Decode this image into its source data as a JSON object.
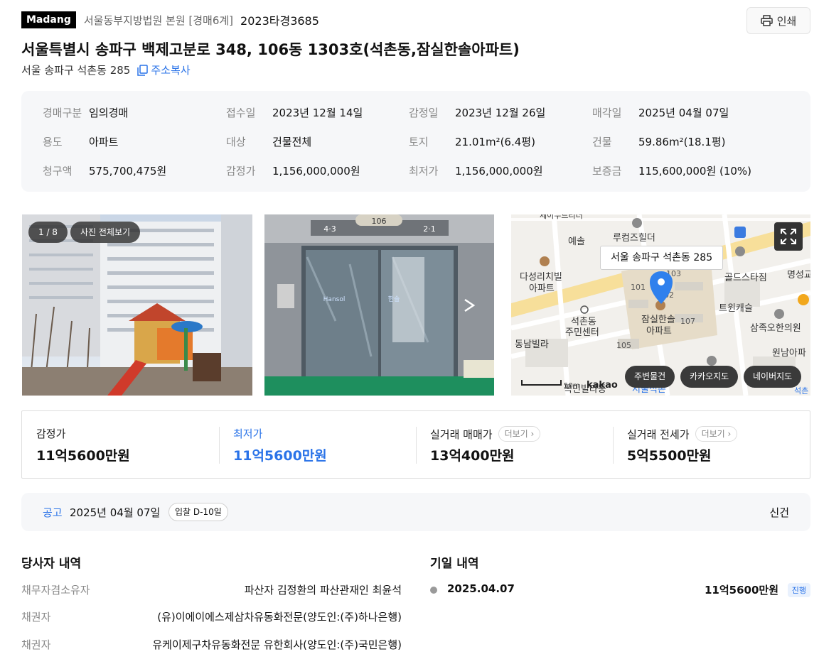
{
  "header": {
    "logo": "Madang",
    "court": "서울동부지방법원 본원 [경매6계]",
    "case_number": "2023타경3685",
    "print_label": "인쇄",
    "title": "서울특별시 송파구 백제고분로 348, 106동 1303호(석촌동,잠실한솔아파트)",
    "lot_address": "서울 송파구 석촌동 285",
    "copy_label": "주소복사"
  },
  "info": [
    [
      {
        "k": "경매구분",
        "v": "임의경매"
      },
      {
        "k": "접수일",
        "v": "2023년 12월 14일"
      },
      {
        "k": "감정일",
        "v": "2023년 12월 26일"
      },
      {
        "k": "매각일",
        "v": "2025년 04월 07일"
      }
    ],
    [
      {
        "k": "용도",
        "v": "아파트"
      },
      {
        "k": "대상",
        "v": "건물전체"
      },
      {
        "k": "토지",
        "v": "21.01m²(6.4평)"
      },
      {
        "k": "건물",
        "v": "59.86m²(18.1평)"
      }
    ],
    [
      {
        "k": "청구액",
        "v": "575,700,475원"
      },
      {
        "k": "감정가",
        "v": "1,156,000,000원"
      },
      {
        "k": "최저가",
        "v": "1,156,000,000원"
      },
      {
        "k": "보증금",
        "v": "115,600,000원 (10%)"
      }
    ]
  ],
  "gallery": {
    "counter": "1 / 8",
    "view_all": "사진 전체보기",
    "building_sign": "106",
    "door_left": "4·3",
    "door_right": "2·1",
    "hansol_left": "Hansol",
    "hansol_right": "한솔"
  },
  "map": {
    "tooltip": "서울 송파구 석촌동 285",
    "btn_nearby": "주변물건",
    "btn_kakao": "카카오지도",
    "btn_naver": "네이버지도",
    "scale": "50m",
    "brand": "kakao",
    "labels": {
      "yesol": "예솔",
      "luxon": "루컴즈힐더",
      "dasung1": "다성리치빌",
      "dasung2": "아파트",
      "gold": "골드스타짐",
      "myungsung": "명성교",
      "twin": "트윈캐슬",
      "samjok": "삼족오한의원",
      "wonnam": "원남아파",
      "seokchon1": "석촌동",
      "seokchon2": "주민센터",
      "jamsil1": "잠실한솔",
      "jamsil2": "아파트",
      "dongnam": "동남빌라",
      "b101": "101",
      "b103": "103",
      "b102": "02",
      "b107": "107",
      "b105": "105",
      "bottom1": "목민빌라동",
      "bottom2": "서울석촌",
      "corner": "석촌",
      "topcut": "세이누드리더"
    }
  },
  "prices": {
    "appraisal_label": "감정가",
    "appraisal_value": "11억5600만원",
    "minimum_label": "최저가",
    "minimum_value": "11억5600만원",
    "sale_label": "실거래 매매가",
    "sale_value": "13억400만원",
    "rent_label": "실거래 전세가",
    "rent_value": "5억5500만원",
    "more_label": "더보기"
  },
  "notice": {
    "label": "공고",
    "date": "2025년 04월 07일",
    "dday": "입찰 D-10일",
    "case_link": "신건"
  },
  "parties": {
    "title": "당사자 내역",
    "rows": [
      {
        "role": "채무자겸소유자",
        "name": "파산자 김정환의 파산관재인 최윤석"
      },
      {
        "role": "채권자",
        "name": "(유)이에이에스제삼차유동화전문(양도인:(주)하나은행)"
      },
      {
        "role": "채권자",
        "name": "유케이제구차유동화전문 유한회사(양도인:(주)국민은행)"
      }
    ]
  },
  "schedule": {
    "title": "기일 내역",
    "date": "2025.04.07",
    "amount": "11억5600만원",
    "status": "진행"
  },
  "colors": {
    "accent": "#2a73e8",
    "panel": "#f6f7f9"
  }
}
